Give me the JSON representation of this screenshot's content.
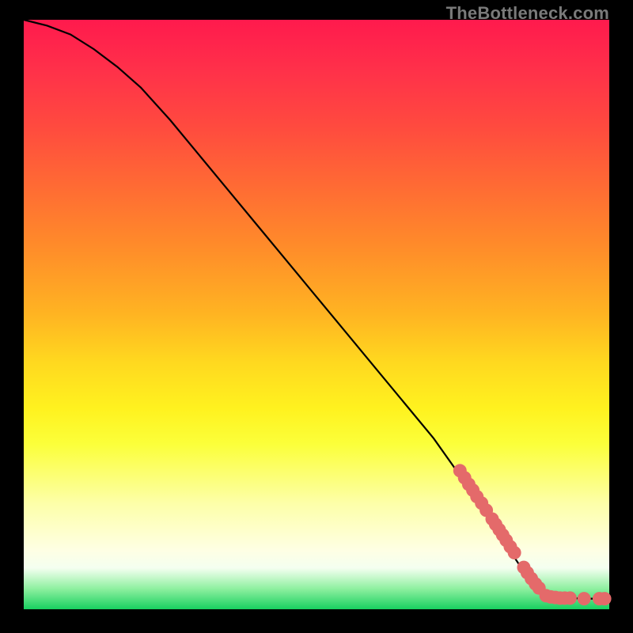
{
  "watermark": "TheBottleneck.com",
  "colors": {
    "background": "#000000",
    "watermark": "#7a7a7a",
    "curve": "#000000",
    "dot": "#e46a6a"
  },
  "chart_data": {
    "type": "line",
    "title": "",
    "xlabel": "",
    "ylabel": "",
    "xlim": [
      0,
      100
    ],
    "ylim": [
      0,
      100
    ],
    "grid": false,
    "legend": false,
    "series": [
      {
        "name": "bottleneck-curve",
        "x": [
          0,
          4,
          8,
          12,
          16,
          20,
          25,
          30,
          35,
          40,
          45,
          50,
          55,
          60,
          65,
          70,
          75,
          80,
          83,
          85,
          88,
          90,
          93,
          96,
          100
        ],
        "y": [
          100,
          99,
          97.5,
          95,
          92,
          88.5,
          83,
          77,
          71,
          65,
          59,
          53,
          47,
          41,
          35,
          29,
          22,
          15,
          10,
          7,
          3.5,
          2.2,
          1.9,
          1.8,
          1.8
        ]
      }
    ],
    "points": [
      {
        "name": "cluster-upper",
        "coords": [
          {
            "x": 74.5,
            "y": 23.5
          },
          {
            "x": 75.3,
            "y": 22.3
          },
          {
            "x": 76.0,
            "y": 21.2
          },
          {
            "x": 76.7,
            "y": 20.2
          },
          {
            "x": 77.4,
            "y": 19.1
          },
          {
            "x": 78.2,
            "y": 18.0
          },
          {
            "x": 79.0,
            "y": 16.8
          }
        ]
      },
      {
        "name": "cluster-mid",
        "coords": [
          {
            "x": 80.0,
            "y": 15.3
          },
          {
            "x": 80.6,
            "y": 14.4
          },
          {
            "x": 81.2,
            "y": 13.5
          },
          {
            "x": 81.8,
            "y": 12.6
          },
          {
            "x": 82.4,
            "y": 11.7
          },
          {
            "x": 83.1,
            "y": 10.6
          },
          {
            "x": 83.8,
            "y": 9.6
          }
        ]
      },
      {
        "name": "cluster-lower",
        "coords": [
          {
            "x": 85.4,
            "y": 7.1
          },
          {
            "x": 86.0,
            "y": 6.2
          },
          {
            "x": 86.7,
            "y": 5.2
          },
          {
            "x": 87.4,
            "y": 4.3
          },
          {
            "x": 88.0,
            "y": 3.6
          }
        ]
      },
      {
        "name": "tail-flat",
        "coords": [
          {
            "x": 89.2,
            "y": 2.3
          },
          {
            "x": 90.0,
            "y": 2.1
          },
          {
            "x": 90.8,
            "y": 2.0
          },
          {
            "x": 91.6,
            "y": 1.9
          },
          {
            "x": 92.4,
            "y": 1.9
          },
          {
            "x": 93.3,
            "y": 1.9
          },
          {
            "x": 95.7,
            "y": 1.8
          },
          {
            "x": 98.3,
            "y": 1.8
          },
          {
            "x": 99.2,
            "y": 1.8
          }
        ]
      }
    ]
  }
}
